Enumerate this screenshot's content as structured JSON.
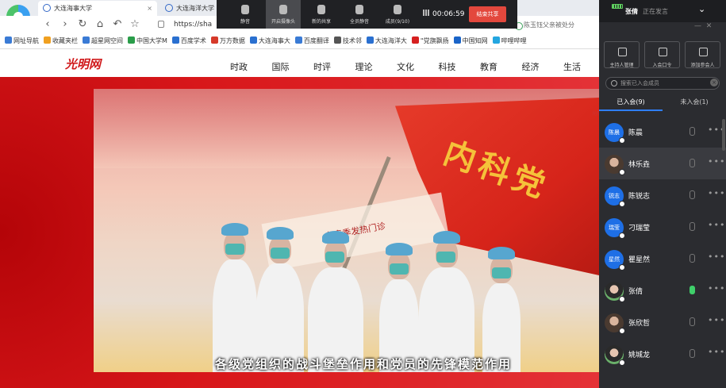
{
  "browser": {
    "tabs": [
      {
        "title": "大连海事大学"
      },
      {
        "title": "大连海洋大学"
      }
    ],
    "address": "https://sha",
    "search_text": "陈玉钰父亲被处分",
    "bookmarks": [
      "网址导航",
      "收藏夹栏",
      "超星网空间",
      "中国大学M",
      "百度学术",
      "万方数据",
      "大连海事大",
      "百度翻译",
      "技术邻",
      "大连海洋大",
      "\"党旗飘扬",
      "中国知网",
      "哔哩哔哩"
    ]
  },
  "site": {
    "logo": "光明网",
    "nav": [
      "时政",
      "国际",
      "时评",
      "理论",
      "文化",
      "科技",
      "教育",
      "经济",
      "生活"
    ]
  },
  "video": {
    "subtitle": "各级党组织的战斗堡垒作用和党员的先锋模范作用",
    "flag_text": "内科党",
    "banner_text": "冬春季发热门诊",
    "watermark": "光明网"
  },
  "meeting_toolbar": {
    "buttons": [
      {
        "label": "静音",
        "icon": "microphone-icon"
      },
      {
        "label": "开启摄像头",
        "icon": "camera-icon"
      },
      {
        "label": "新的共享",
        "icon": "share-screen-icon"
      },
      {
        "label": "全员静音",
        "icon": "mute-all-icon"
      },
      {
        "label": "成员(9/10)",
        "icon": "members-icon"
      }
    ],
    "timer": "00:06:59",
    "end_label": "结束共享"
  },
  "panel": {
    "speaker_name": "张倩",
    "speaker_status": "正在发言",
    "actions": [
      {
        "label": "主持人管理",
        "icon": "menu-icon"
      },
      {
        "label": "入会口令",
        "icon": "external-link-icon"
      },
      {
        "label": "添加参会人",
        "icon": "add-person-icon"
      }
    ],
    "search_placeholder": "搜索已入会成员",
    "tabs": [
      "已入会(9)",
      "未入会(1)"
    ],
    "members": [
      {
        "name": "陈晨",
        "avatar": "陈晨",
        "mic": "muted"
      },
      {
        "name": "林乐垚",
        "avatar": "",
        "mic": "muted"
      },
      {
        "name": "陈锐志",
        "avatar": "锐志",
        "mic": "muted"
      },
      {
        "name": "刁瑞莹",
        "avatar": "瑞莹",
        "mic": "muted"
      },
      {
        "name": "瞿星然",
        "avatar": "星然",
        "mic": "muted"
      },
      {
        "name": "张倩",
        "avatar": "",
        "mic": "speaking"
      },
      {
        "name": "张欣哲",
        "avatar": "",
        "mic": "muted"
      },
      {
        "name": "姚城龙",
        "avatar": "",
        "mic": "muted"
      }
    ],
    "colors": {
      "accent": "#2f7fff",
      "end": "#e3483d",
      "speaking": "#3fcf6a"
    }
  }
}
